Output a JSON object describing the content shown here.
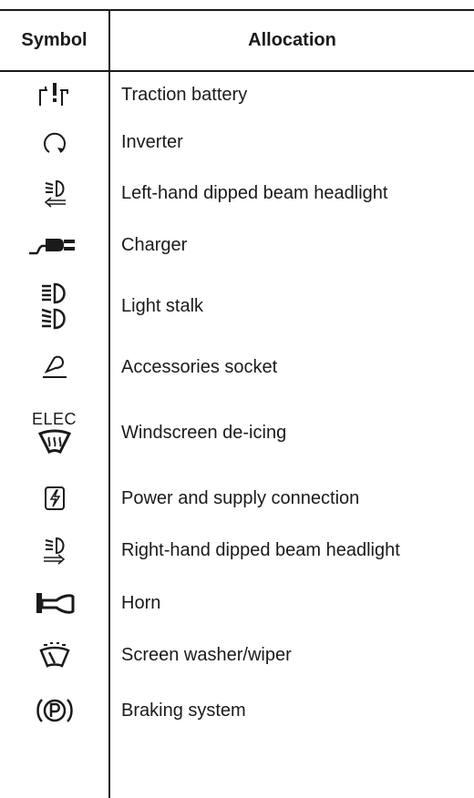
{
  "header": {
    "symbol": "Symbol",
    "allocation": "Allocation"
  },
  "rows": [
    {
      "icon": "traction-battery-icon",
      "label": "Traction battery"
    },
    {
      "icon": "inverter-icon",
      "label": "Inverter"
    },
    {
      "icon": "left-dipped-beam-icon",
      "label": "Left-hand dipped beam headlight"
    },
    {
      "icon": "charger-plug-icon",
      "label": "Charger"
    },
    {
      "icon": "light-stalk-icon",
      "label": "Light stalk"
    },
    {
      "icon": "accessories-socket-icon",
      "label": "Accessories socket"
    },
    {
      "icon": "windscreen-de-icing-icon",
      "label": "Windscreen de-icing",
      "icon_text": "ELEC"
    },
    {
      "icon": "power-supply-icon",
      "label": "Power and supply connection"
    },
    {
      "icon": "right-dipped-beam-icon",
      "label": "Right-hand dipped beam headlight"
    },
    {
      "icon": "horn-icon",
      "label": "Horn"
    },
    {
      "icon": "screen-washer-wiper-icon",
      "label": "Screen washer/wiper"
    },
    {
      "icon": "braking-system-icon",
      "label": "Braking system"
    }
  ]
}
